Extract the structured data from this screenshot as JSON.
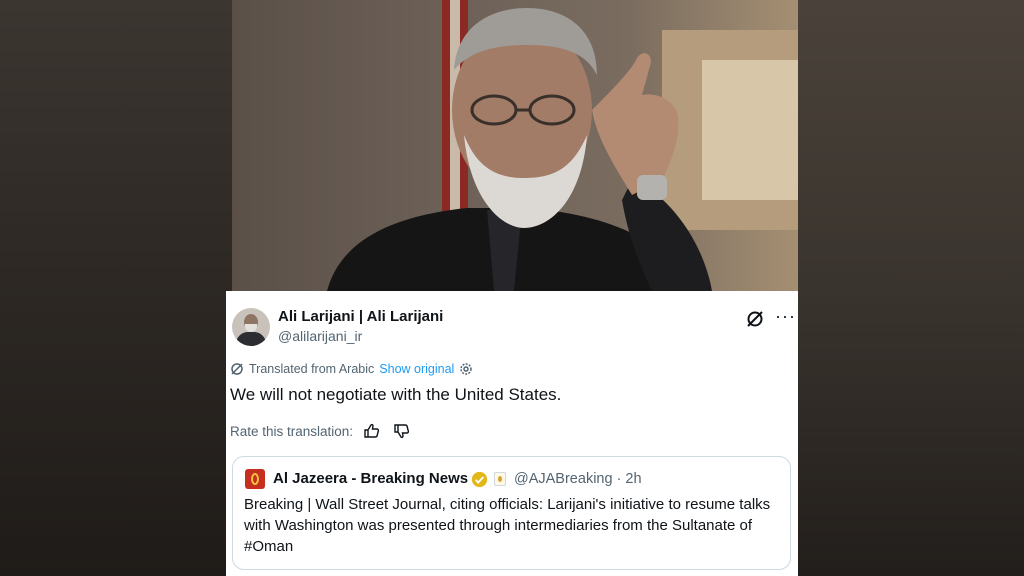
{
  "tweet": {
    "author_name": "Ali Larijani | Ali Larijani",
    "author_handle": "@alilarijani_ir",
    "translated_label": "Translated from Arabic",
    "show_original": "Show original",
    "text": "We will not negotiate with the United States.",
    "rate_label": "Rate this translation:"
  },
  "quote": {
    "author_name": "Al Jazeera - Breaking News",
    "meta": "@AJABreaking · 2h",
    "text": "Breaking | Wall Street Journal, citing officials: Larijani's initiative to resume talks with Washington was presented through intermediaries from the Sultanate of #Oman"
  },
  "icons": {
    "grok": "grok-icon",
    "more": "more-icon",
    "translate": "translate-icon",
    "settings": "gear-icon",
    "thumbs_up": "thumbs-up-icon",
    "thumbs_down": "thumbs-down-icon",
    "verified": "verified-badge-icon"
  },
  "colors": {
    "link": "#1d9bf0",
    "secondary_text": "#536471",
    "verified_gold": "#e2b719",
    "aj_brand": "#c62f1f"
  }
}
